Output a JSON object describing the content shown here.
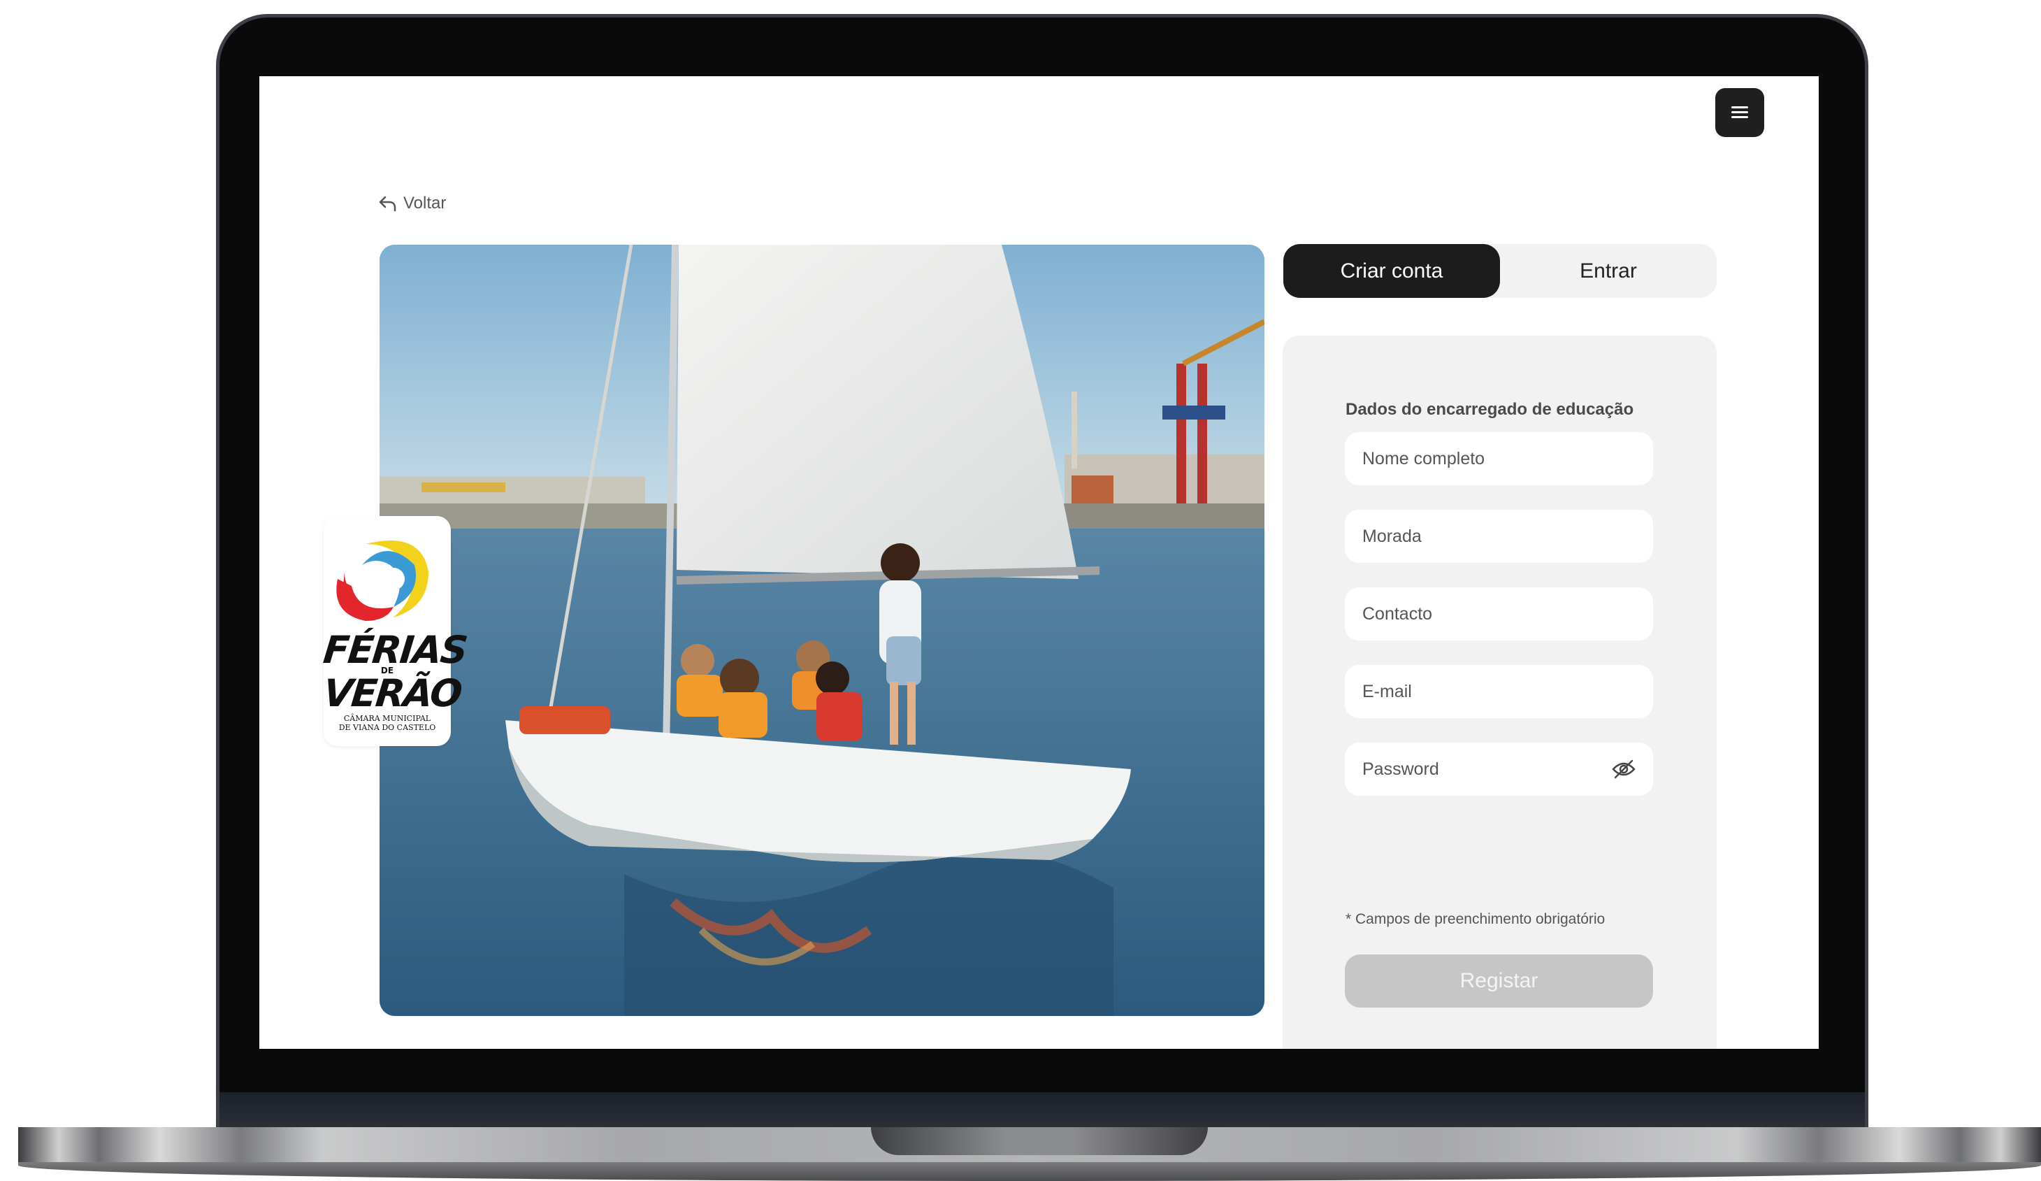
{
  "nav": {
    "back_label": "Voltar",
    "menu_icon": "hamburger-menu-icon"
  },
  "brand": {
    "line1": "FÉRIAS",
    "connector": "DE",
    "line2": "VERÃO",
    "subline1": "CÂMARA MUNICIPAL",
    "subline2": "DE VIANA DO CASTELO"
  },
  "tabs": [
    {
      "label": "Criar conta",
      "active": true
    },
    {
      "label": "Entrar",
      "active": false
    }
  ],
  "form": {
    "section_title": "Dados do encarregado de educação",
    "fields": [
      {
        "placeholder": "Nome completo"
      },
      {
        "placeholder": "Morada"
      },
      {
        "placeholder": "Contacto"
      },
      {
        "placeholder": "E-mail"
      },
      {
        "placeholder": "Password",
        "icon": "eye-off-icon"
      }
    ],
    "required_note": "* Campos  de preenchimento obrigatório",
    "submit_label": "Registar"
  },
  "colors": {
    "active_tab": "#1c1c1c",
    "panel_bg": "#f2f2f2",
    "submit_disabled": "#c6c6c6"
  }
}
